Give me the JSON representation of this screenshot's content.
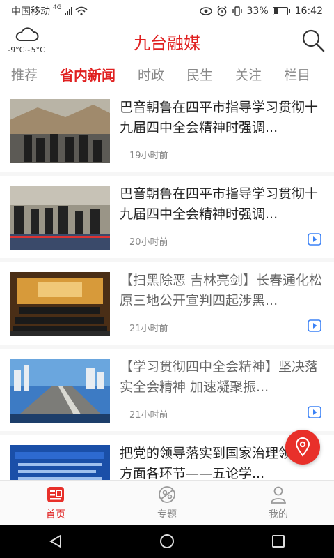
{
  "status": {
    "carrier": "中国移动",
    "network": "4G",
    "battery": "33%",
    "battery_level": 0.33,
    "time": "16:42"
  },
  "weather": {
    "temp": "-9°C~5°C"
  },
  "app": {
    "title": "九台融媒"
  },
  "tabs": [
    {
      "label": "推荐"
    },
    {
      "label": "省内新闻"
    },
    {
      "label": "时政"
    },
    {
      "label": "民生"
    },
    {
      "label": "关注"
    },
    {
      "label": "栏目"
    }
  ],
  "articles": [
    {
      "title": "巴音朝鲁在四平市指导学习贯彻十九届四中全会精神时强调...",
      "time": "19小时前"
    },
    {
      "title": "巴音朝鲁在四平市指导学习贯彻十九届四中全会精神时强调...",
      "time": "20小时前"
    },
    {
      "title": "【扫黑除恶 吉林亮剑】长春通化松原三地公开宣判四起涉黑...",
      "time": "21小时前"
    },
    {
      "title": "【学习贯彻四中全会精神】坚决落实全会精神 加速凝聚振...",
      "time": "21小时前"
    },
    {
      "title": "把党的领导落实到国家治理领域各方面各环节——五论学...",
      "time": ""
    }
  ],
  "bottom_nav": [
    {
      "label": "首页"
    },
    {
      "label": "专题"
    },
    {
      "label": "我的"
    }
  ],
  "colors": {
    "accent": "#e02020",
    "fab": "#e8302a"
  }
}
